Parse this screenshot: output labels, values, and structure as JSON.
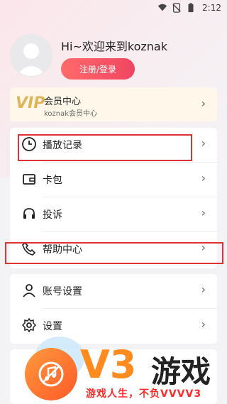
{
  "status": {
    "time": "2:12"
  },
  "profile": {
    "greeting": "Hi~欢迎来到koznak",
    "login_label": "注册/登录"
  },
  "vip": {
    "logo": "VIP",
    "title": "会员中心",
    "subtitle": "koznak会员中心"
  },
  "menu_group1": [
    {
      "label": "播放记录",
      "icon": "clock-icon"
    },
    {
      "label": "卡包",
      "icon": "wallet-icon"
    },
    {
      "label": "投诉",
      "icon": "headset-icon"
    },
    {
      "label": "帮助中心",
      "icon": "phone-icon"
    }
  ],
  "menu_group2": [
    {
      "label": "账号设置",
      "icon": "user-icon"
    },
    {
      "label": "设置",
      "icon": "gear-icon"
    }
  ],
  "watermark": {
    "brand": "V3",
    "brand_cn": "游戏",
    "tagline": "游戏人生，不负VVVV3"
  },
  "colors": {
    "accent": "#f04561",
    "highlight": "#d33333",
    "watermark_orange": "#ff8a1e"
  }
}
